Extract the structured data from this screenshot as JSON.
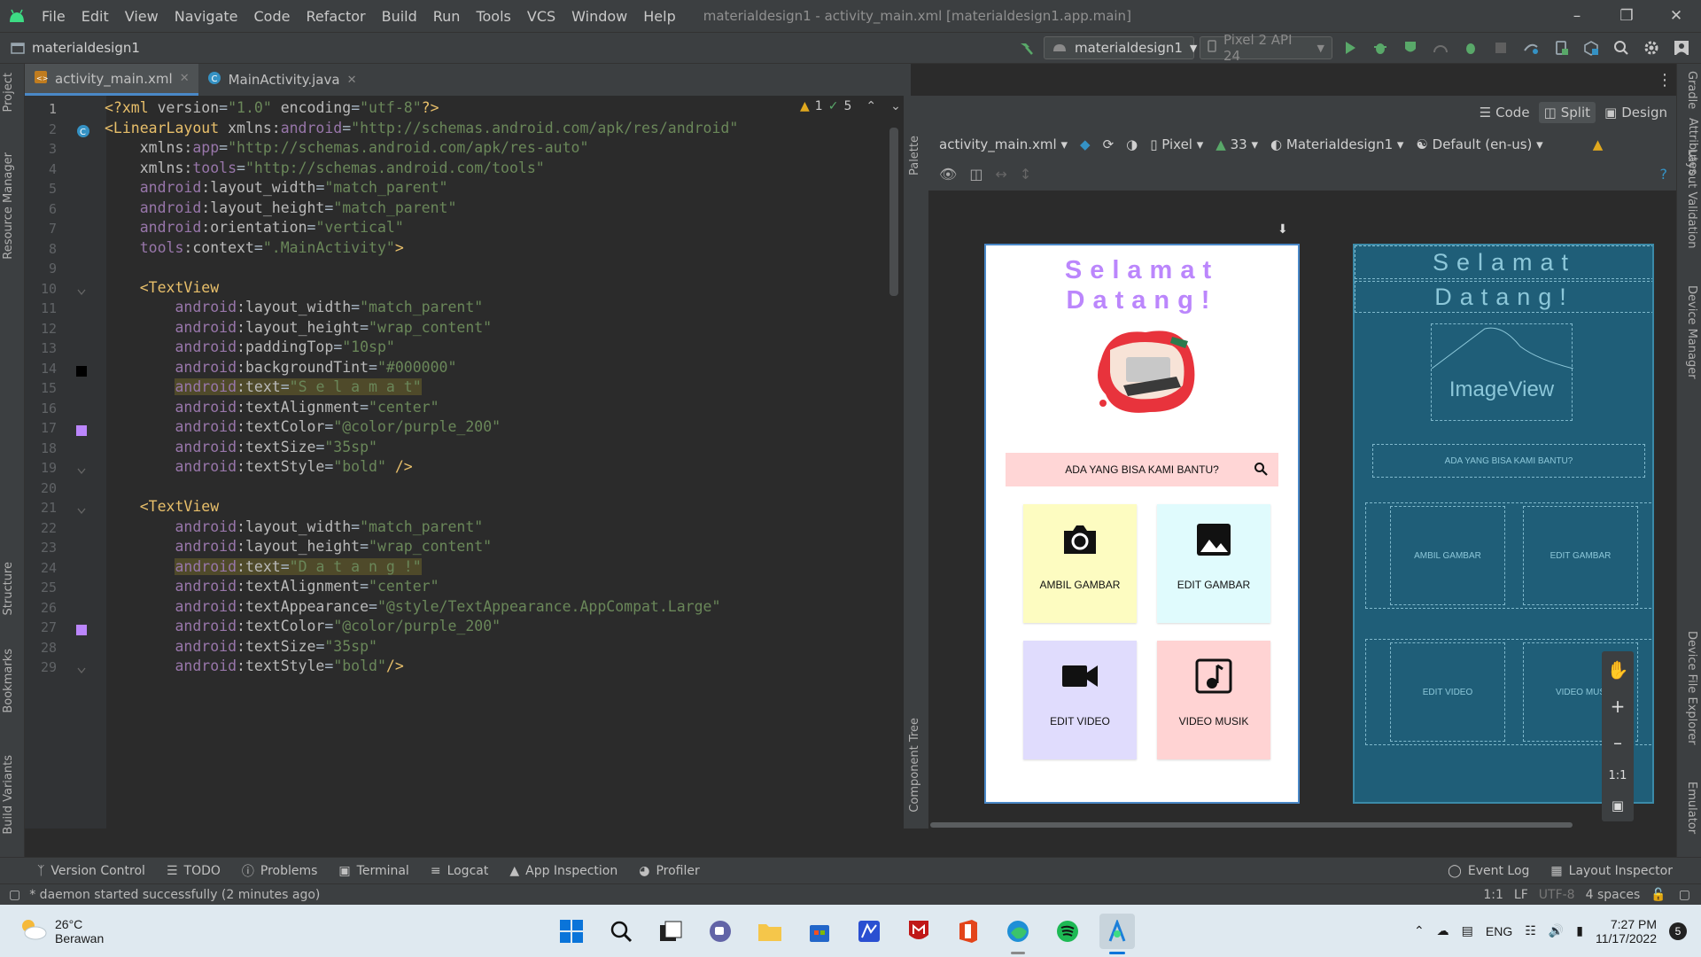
{
  "menubar": {
    "items": [
      "File",
      "Edit",
      "View",
      "Navigate",
      "Code",
      "Refactor",
      "Build",
      "Run",
      "Tools",
      "VCS",
      "Window",
      "Help"
    ],
    "title": "materialdesign1 - activity_main.xml [materialdesign1.app.main]"
  },
  "navbar": {
    "project": "materialdesign1",
    "run_config": "materialdesign1",
    "device": "Pixel 2 API 24"
  },
  "tabs": [
    {
      "label": "activity_main.xml"
    },
    {
      "label": "MainActivity.java"
    }
  ],
  "side_tools_left": [
    "Project",
    "Resource Manager",
    "Structure",
    "Bookmarks",
    "Build Variants"
  ],
  "side_tools_right": [
    "Gradle",
    "Layout Validation",
    "Device Manager",
    "Device File Explorer",
    "Emulator"
  ],
  "inspection": {
    "warnings": "1",
    "weak_warnings": "5"
  },
  "code_lines": [
    {
      "n": "1",
      "html": "<span class=\"t\">&lt;?xml </span><span class=\"a\">version</span>=<span class=\"v\">\"1.0\"</span> <span class=\"a\">encoding</span>=<span class=\"v\">\"utf-8\"</span><span class=\"t\">?&gt;</span>"
    },
    {
      "n": "2",
      "html": "<span class=\"t\">&lt;LinearLayout </span><span class=\"a\">xmlns:</span><span class=\"ns\">android</span>=<span class=\"v\">\"http://schemas.android.com/apk/res/android\"</span>"
    },
    {
      "n": "3",
      "html": "    <span class=\"a\">xmlns:</span><span class=\"ns\">app</span>=<span class=\"v\">\"http://schemas.android.com/apk/res-auto\"</span>"
    },
    {
      "n": "4",
      "html": "    <span class=\"a\">xmlns:</span><span class=\"ns\">tools</span>=<span class=\"v\">\"http://schemas.android.com/tools\"</span>"
    },
    {
      "n": "5",
      "html": "    <span class=\"ns\">android</span><span class=\"a\">:layout_width</span>=<span class=\"v\">\"match_parent\"</span>"
    },
    {
      "n": "6",
      "html": "    <span class=\"ns\">android</span><span class=\"a\">:layout_height</span>=<span class=\"v\">\"match_parent\"</span>"
    },
    {
      "n": "7",
      "html": "    <span class=\"ns\">android</span><span class=\"a\">:orientation</span>=<span class=\"v\">\"vertical\"</span>"
    },
    {
      "n": "8",
      "html": "    <span class=\"ns\">tools</span><span class=\"a\">:context</span>=<span class=\"v\">\".MainActivity\"</span><span class=\"t\">&gt;</span>"
    },
    {
      "n": "9",
      "html": ""
    },
    {
      "n": "10",
      "html": "    <span class=\"t\">&lt;TextView</span>"
    },
    {
      "n": "11",
      "html": "        <span class=\"ns\">android</span><span class=\"a\">:layout_width</span>=<span class=\"v\">\"match_parent\"</span>"
    },
    {
      "n": "12",
      "html": "        <span class=\"ns\">android</span><span class=\"a\">:layout_height</span>=<span class=\"v\">\"wrap_content\"</span>"
    },
    {
      "n": "13",
      "html": "        <span class=\"ns\">android</span><span class=\"a\">:paddingTop</span>=<span class=\"v\">\"10sp\"</span>"
    },
    {
      "n": "14",
      "html": "        <span class=\"ns\">android</span><span class=\"a\">:backgroundTint</span>=<span class=\"v\">\"#000000\"</span>"
    },
    {
      "n": "15",
      "html": "        <span class=\"hl\"><span class=\"ns\">android</span><span class=\"a\">:text</span>=<span class=\"v\">\"S e l a m a t\"</span></span>"
    },
    {
      "n": "16",
      "html": "        <span class=\"ns\">android</span><span class=\"a\">:textAlignment</span>=<span class=\"v\">\"center\"</span>"
    },
    {
      "n": "17",
      "html": "        <span class=\"ns\">android</span><span class=\"a\">:textColor</span>=<span class=\"v\">\"@color/purple_200\"</span>"
    },
    {
      "n": "18",
      "html": "        <span class=\"ns\">android</span><span class=\"a\">:textSize</span>=<span class=\"v\">\"35sp\"</span>"
    },
    {
      "n": "19",
      "html": "        <span class=\"ns\">android</span><span class=\"a\">:textStyle</span>=<span class=\"v\">\"bold\"</span> <span class=\"t\">/&gt;</span>"
    },
    {
      "n": "20",
      "html": ""
    },
    {
      "n": "21",
      "html": "    <span class=\"t\">&lt;TextView</span>"
    },
    {
      "n": "22",
      "html": "        <span class=\"ns\">android</span><span class=\"a\">:layout_width</span>=<span class=\"v\">\"match_parent\"</span>"
    },
    {
      "n": "23",
      "html": "        <span class=\"ns\">android</span><span class=\"a\">:layout_height</span>=<span class=\"v\">\"wrap_content\"</span>"
    },
    {
      "n": "24",
      "html": "        <span class=\"hl\"><span class=\"ns\">android</span><span class=\"a\">:text</span>=<span class=\"v\">\"D a t a n g !\"</span></span>"
    },
    {
      "n": "25",
      "html": "        <span class=\"ns\">android</span><span class=\"a\">:textAlignment</span>=<span class=\"v\">\"center\"</span>"
    },
    {
      "n": "26",
      "html": "        <span class=\"ns\">android</span><span class=\"a\">:textAppearance</span>=<span class=\"v\">\"@style/TextAppearance.AppCompat.Large\"</span>"
    },
    {
      "n": "27",
      "html": "        <span class=\"ns\">android</span><span class=\"a\">:textColor</span>=<span class=\"v\">\"@color/purple_200\"</span>"
    },
    {
      "n": "28",
      "html": "        <span class=\"ns\">android</span><span class=\"a\">:textSize</span>=<span class=\"v\">\"35sp\"</span>"
    },
    {
      "n": "29",
      "html": "        <span class=\"ns\">android</span><span class=\"a\">:textStyle</span>=<span class=\"v\">\"bold\"</span><span class=\"t\">/&gt;</span>"
    }
  ],
  "design": {
    "modes": {
      "code": "Code",
      "split": "Split",
      "design": "Design"
    },
    "file": "activity_main.xml",
    "device": "Pixel",
    "api": "33",
    "theme": "Materialdesign1",
    "locale": "Default (en-us)",
    "palette": "Palette",
    "component_tree": "Component Tree",
    "attributes": "Attributes"
  },
  "phone": {
    "title1": "Selamat",
    "title2": "Datang!",
    "search": "ADA YANG BISA KAMI BANTU?",
    "cards": [
      {
        "label": "AMBIL GAMBAR",
        "icon": "camera-icon",
        "color": "#fdfcc1"
      },
      {
        "label": "EDIT GAMBAR",
        "icon": "image-icon",
        "color": "#e0fbfd"
      },
      {
        "label": "EDIT VIDEO",
        "icon": "video-camera-icon",
        "color": "#e0dcfd"
      },
      {
        "label": "VIDEO MUSIK",
        "icon": "music-note-icon",
        "color": "#ffd3d3"
      }
    ]
  },
  "blueprint": {
    "title1": "Selamat",
    "title2": "Datang!",
    "image": "ImageView",
    "search": "ADA YANG BISA KAMI BANTU?",
    "cards": [
      "AMBIL GAMBAR",
      "EDIT GAMBAR",
      "EDIT VIDEO",
      "VIDEO MUS"
    ]
  },
  "zoom": {
    "fit": "1:1"
  },
  "bottom_tabs": [
    "Version Control",
    "TODO",
    "Problems",
    "Terminal",
    "Logcat",
    "App Inspection",
    "Profiler"
  ],
  "bottom_right": [
    "Event Log",
    "Layout Inspector"
  ],
  "status": {
    "message": "* daemon started successfully (2 minutes ago)",
    "position": "1:1",
    "line_sep": "LF",
    "encoding": "UTF-8",
    "indent": "4 spaces"
  },
  "taskbar": {
    "temp": "26°C",
    "weather": "Berawan",
    "lang": "ENG",
    "time": "7:27 PM",
    "date": "11/17/2022",
    "notif": "5"
  }
}
